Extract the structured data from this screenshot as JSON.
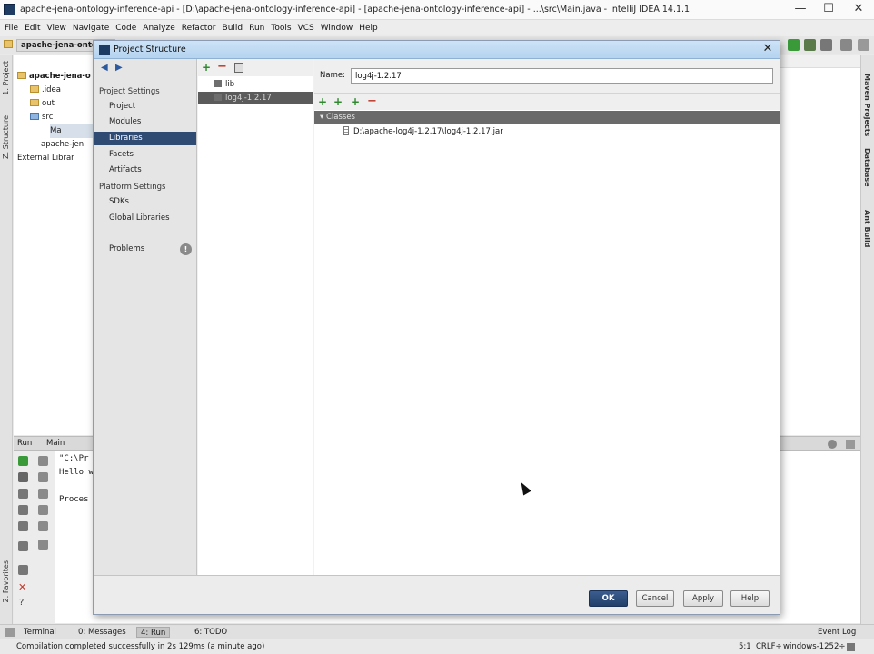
{
  "window": {
    "title": "apache-jena-ontology-inference-api - [D:\\apache-jena-ontology-inference-api] - [apache-jena-ontology-inference-api] - ...\\src\\Main.java - IntelliJ IDEA 14.1.1",
    "minimize": "—",
    "maximize": "☐",
    "close": "✕"
  },
  "menu": [
    "File",
    "Edit",
    "View",
    "Navigate",
    "Code",
    "Analyze",
    "Refactor",
    "Build",
    "Run",
    "Tools",
    "VCS",
    "Window",
    "Help"
  ],
  "navbar": {
    "crumb": "apache-jena-ontolog"
  },
  "left_strip": {
    "project_tab": "1: Project",
    "structure_tab": "Z: Structure",
    "favorites_tab": "2: Favorites"
  },
  "right_strip": {
    "maven": "Maven Projects",
    "database": "Database",
    "ant": "Ant Build"
  },
  "project_tree": {
    "root": "apache-jena-o",
    "idea": ".idea",
    "out": "out",
    "src": "src",
    "main": "Ma",
    "iml": "apache-jen",
    "external": "External Librar"
  },
  "run_panel": {
    "header_run": "Run",
    "header_main": "Main",
    "console": [
      "\"C:\\Pr",
      "Hello w",
      "",
      "Proces"
    ]
  },
  "bottom_tabs": {
    "terminal": "Terminal",
    "messages": "0: Messages",
    "run": "4: Run",
    "todo": "6: TODO",
    "event_log": "Event Log"
  },
  "status": {
    "message": "Compilation completed successfully in 2s 129ms (a minute ago)",
    "position": "5:1",
    "line_sep": "CRLF÷",
    "encoding": "windows-1252÷"
  },
  "dialog": {
    "title": "Project Structure",
    "close": "✕",
    "project_settings_header": "Project Settings",
    "project_settings": [
      "Project",
      "Modules",
      "Libraries",
      "Facets",
      "Artifacts"
    ],
    "selected_item": "Libraries",
    "platform_settings_header": "Platform Settings",
    "platform_settings": [
      "SDKs",
      "Global Libraries"
    ],
    "problems": "Problems",
    "problems_badge": "!",
    "libraries": [
      "lib",
      "log4j-1.2.17"
    ],
    "name_label": "Name:",
    "name_value": "log4j-1.2.17",
    "classes_label": "Classes",
    "jar_path": "D:\\apache-log4j-1.2.17\\log4j-1.2.17.jar",
    "buttons": {
      "ok": "OK",
      "cancel": "Cancel",
      "apply": "Apply",
      "help": "Help"
    }
  }
}
